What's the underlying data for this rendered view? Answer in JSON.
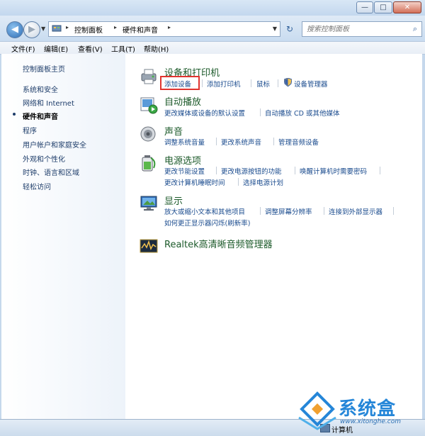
{
  "window": {
    "minimize_glyph": "—",
    "maximize_glyph": "□",
    "close_glyph": "✕"
  },
  "nav": {
    "back_glyph": "◀",
    "forward_glyph": "▶",
    "history_glyph": "▼"
  },
  "address": {
    "crumbs": [
      "控制面板",
      "硬件和声音"
    ],
    "sep_glyph": "▸",
    "dropdown_glyph": "▼",
    "refresh_glyph": "↻"
  },
  "search": {
    "placeholder": "搜索控制面板",
    "icon_glyph": "⌕"
  },
  "menu": [
    "文件(F)",
    "编辑(E)",
    "查看(V)",
    "工具(T)",
    "帮助(H)"
  ],
  "sidebar": {
    "home": "控制面板主页",
    "items": [
      "系统和安全",
      "网络和 Internet",
      "硬件和声音",
      "程序",
      "用户帐户和家庭安全",
      "外观和个性化",
      "时钟、语言和区域",
      "轻松访问"
    ]
  },
  "categories": [
    {
      "title": "设备和打印机",
      "links": [
        "添加设备",
        "添加打印机",
        "鼠标",
        "设备管理器"
      ]
    },
    {
      "title": "自动播放",
      "links": [
        "更改媒体或设备的默认设置",
        "自动播放 CD 或其他媒体"
      ]
    },
    {
      "title": "声音",
      "links": [
        "调整系统音量",
        "更改系统声音",
        "管理音频设备"
      ]
    },
    {
      "title": "电源选项",
      "links": [
        "更改节能设置",
        "更改电源按钮的功能",
        "唤醒计算机时需要密码",
        "更改计算机睡眠时间",
        "选择电源计划"
      ]
    },
    {
      "title": "显示",
      "links": [
        "放大或缩小文本和其他项目",
        "调整屏幕分辨率",
        "连接到外部显示器",
        "如何更正显示器闪烁(刷新率)"
      ]
    },
    {
      "title": "Realtek高清晰音频管理器",
      "links": []
    }
  ],
  "status": {
    "computer": "计算机"
  },
  "watermark": {
    "brand": "系统盒",
    "url": "www.xitonghe.com"
  },
  "colors": {
    "link": "#1a4b8e",
    "category_title": "#1c5a2a",
    "highlight_box": "#e0342f"
  }
}
